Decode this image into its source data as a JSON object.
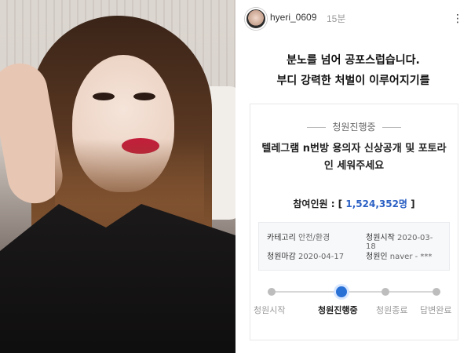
{
  "story": {
    "username": "hyeri_0609",
    "time": "15분",
    "menu_icon": "more-icon",
    "headline": {
      "line1": "분노를 넘어 공포스럽습니다.",
      "line2": "부디 강력한 처벌이 이루어지기를"
    },
    "petition": {
      "status": "청원진행중",
      "title": "텔레그램 n번방 용의자 신상공개 및 포토라인 세워주세요",
      "participants_label": "참여인원 : [",
      "participants_value": "1,524,352명",
      "participants_close": " ]",
      "info": {
        "category_label": "카테고리",
        "category_value": "안전/환경",
        "start_label": "청원시작",
        "start_value": "2020-03-18",
        "end_label": "청원마감",
        "end_value": "2020-04-17",
        "petitioner_label": "청원인",
        "petitioner_value": "naver - ***"
      },
      "progress_steps": [
        "청원시작",
        "청원진행중",
        "청원종료",
        "답변완료"
      ],
      "active_step_index": 1
    }
  }
}
